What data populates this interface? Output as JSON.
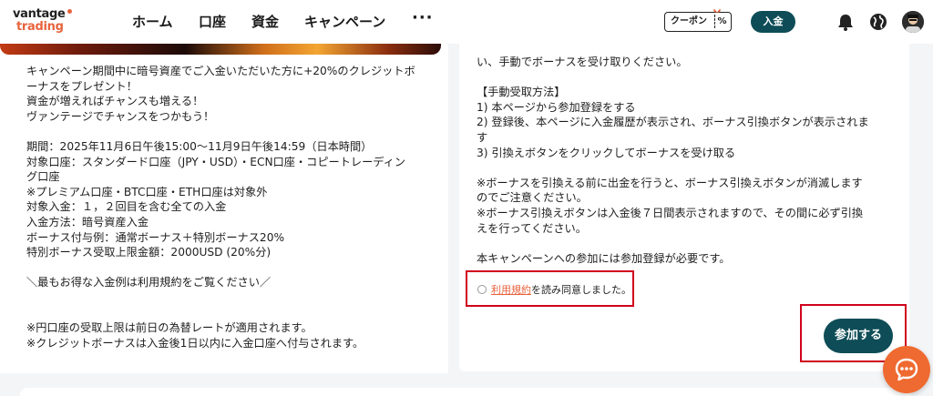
{
  "header": {
    "logo_top": "vantage",
    "logo_bottom": "trading",
    "nav": [
      "ホーム",
      "口座",
      "資金",
      "キャンペーン",
      "···"
    ],
    "coupon_label": "クーポン",
    "coupon_symbol": "%",
    "deposit_label": "入金",
    "icons": [
      "bell-icon",
      "globe-icon",
      "avatar"
    ]
  },
  "left": {
    "lines": [
      "キャンペーン期間中に暗号資産でご入金いただいた方に+20%のクレジットボ",
      "ーナスをプレゼント！",
      "資金が増えればチャンスも増える！",
      "ヴァンテージでチャンスをつかもう！",
      "",
      "期間：2025年11月6日午後15:00～11月9日午後14:59（日本時間）",
      "対象口座：スタンダード口座（JPY・USD）・ECN口座・コピートレーディン",
      "グ口座",
      "※プレミアム口座・BTC口座・ETH口座は対象外",
      "対象入金：１，２回目を含む全ての入金",
      "入金方法：暗号資産入金",
      "ボーナス付与例：通常ボーナス＋特別ボーナス20%",
      "特別ボーナス受取上限金額：2000USD (20%分)",
      "",
      "＼最もお得な入金例は利用規約をご覧ください／",
      "",
      "",
      "※円口座の受取上限は前日の為替レートが適用されます。",
      "※クレジットボーナスは入金後1日以内に入金口座へ付与されます。"
    ]
  },
  "right": {
    "lines": [
      "い、手動でボーナスを受け取りください。",
      "",
      "【手動受取方法】",
      "1) 本ページから参加登録をする",
      "2) 登録後、本ページに入金履歴が表示され、ボーナス引換ボタンが表示されま",
      "す",
      "3) 引換えボタンをクリックしてボーナスを受け取る",
      "",
      "※ボーナスを引換える前に出金を行うと、ボーナス引換えボタンが消滅します",
      "のでご注意ください。",
      "※ボーナス引換えボタンは入金後７日間表示されますので、その間に必ず引換",
      "えを行ってください。",
      "",
      "本キャンペーンへの参加には参加登録が必要です。"
    ],
    "terms_link": "利用規約",
    "terms_suffix": "を読み同意しました。",
    "join_label": "参加する"
  },
  "colors": {
    "brand_dark": "#0e4d57",
    "brand_orange": "#e8633c",
    "highlight_red": "#d0021b"
  }
}
